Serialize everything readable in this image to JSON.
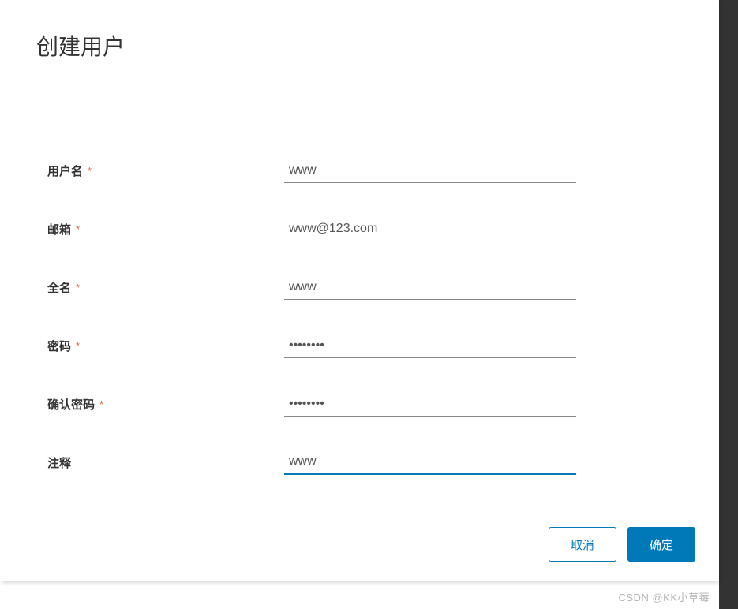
{
  "modal": {
    "title": "创建用户"
  },
  "form": {
    "username": {
      "label": "用户名",
      "required": "*",
      "value": "www"
    },
    "email": {
      "label": "邮箱",
      "required": "*",
      "value": "www@123.com"
    },
    "fullname": {
      "label": "全名",
      "required": "*",
      "value": "www"
    },
    "password": {
      "label": "密码",
      "required": "*",
      "value": "••••••••"
    },
    "confirm_password": {
      "label": "确认密码",
      "required": "*",
      "value": "••••••••"
    },
    "comment": {
      "label": "注释",
      "value": "www"
    }
  },
  "buttons": {
    "cancel": "取消",
    "confirm": "确定"
  },
  "watermark": "CSDN @KK小草莓"
}
